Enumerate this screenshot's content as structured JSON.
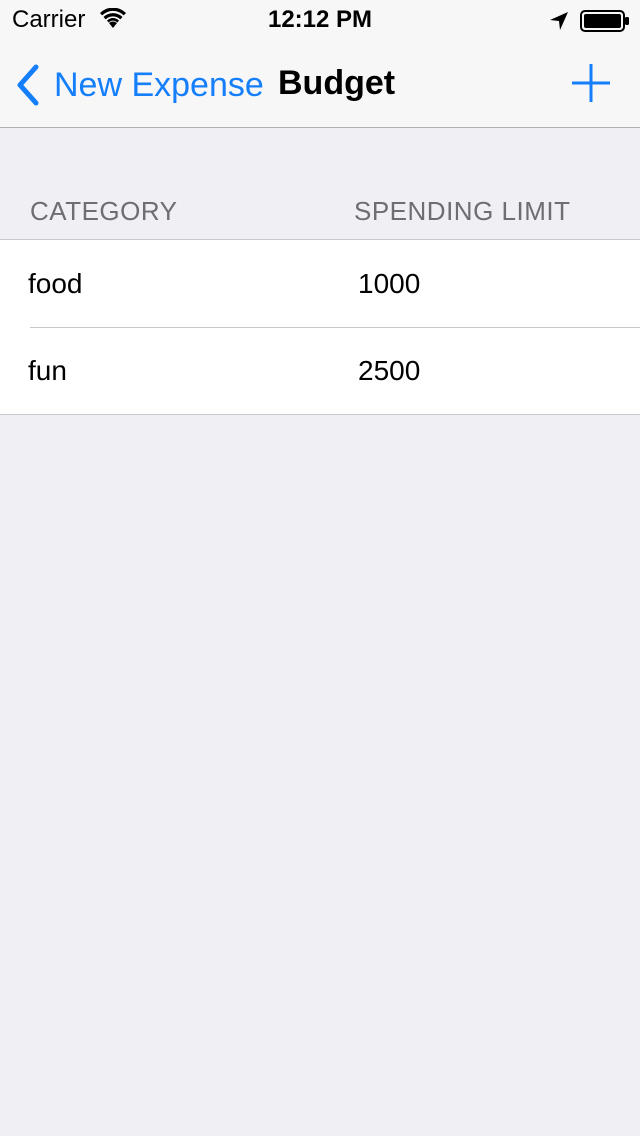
{
  "status_bar": {
    "carrier": "Carrier",
    "time": "12:12 PM",
    "icons": [
      "wifi-icon",
      "location-arrow-icon",
      "battery-icon"
    ]
  },
  "nav_bar": {
    "back_label": "New Expense",
    "title": "Budget",
    "add_icon": "plus-icon",
    "back_icon": "chevron-left-icon"
  },
  "table": {
    "columns": {
      "category": "CATEGORY",
      "limit": "SPENDING LIMIT"
    },
    "rows": [
      {
        "category": "food",
        "limit": "1000"
      },
      {
        "category": "fun",
        "limit": "2500"
      }
    ]
  },
  "colors": {
    "accent": "#147efb",
    "background": "#efeff4",
    "header_text": "#6d6d72",
    "separator": "#c8c7cc"
  }
}
